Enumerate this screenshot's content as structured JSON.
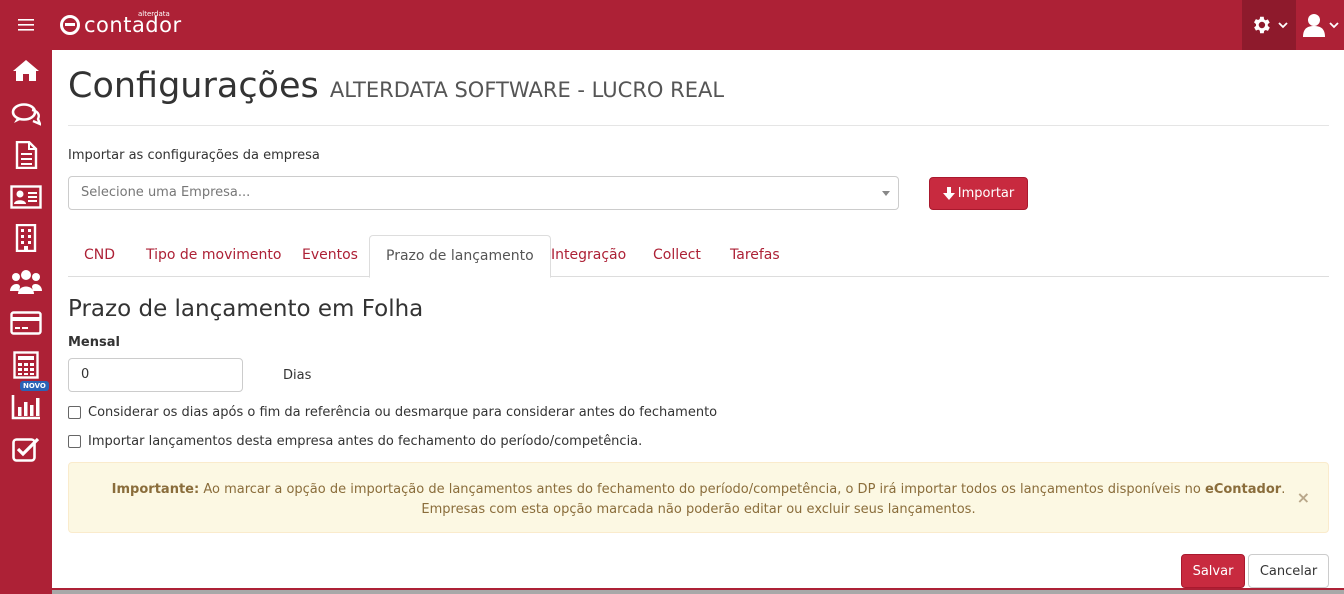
{
  "header": {
    "brand_small": "alterdata",
    "brand_word": "contador",
    "brand_color": "#ad2136"
  },
  "sidebar": {
    "items": [
      {
        "icon": "home-icon"
      },
      {
        "icon": "chat-icon"
      },
      {
        "icon": "document-icon"
      },
      {
        "icon": "contact-card-icon"
      },
      {
        "icon": "building-icon"
      },
      {
        "icon": "users-icon"
      },
      {
        "icon": "credit-card-icon"
      },
      {
        "icon": "calculator-icon"
      },
      {
        "icon": "bar-chart-icon"
      },
      {
        "icon": "checkbox-icon"
      }
    ],
    "novo_badge": "NOVO"
  },
  "page": {
    "title": "Configurações",
    "company": "ALTERDATA SOFTWARE - LUCRO REAL"
  },
  "import": {
    "label": "Importar as configurações da empresa",
    "select_placeholder": "Selecione uma Empresa...",
    "button": "Importar"
  },
  "tabs": [
    {
      "label": "CND",
      "active": false
    },
    {
      "label": "Tipo de movimento",
      "active": false
    },
    {
      "label": "Eventos",
      "active": false
    },
    {
      "label": "Prazo de lançamento",
      "active": true
    },
    {
      "label": "Integração",
      "active": false
    },
    {
      "label": "Collect",
      "active": false
    },
    {
      "label": "Tarefas",
      "active": false
    }
  ],
  "section": {
    "title": "Prazo de lançamento em Folha",
    "mensal_label": "Mensal",
    "mensal_value": "0",
    "dias_label": "Dias",
    "checkbox1": "Considerar os dias após o fim da referência ou desmarque para considerar antes do fechamento",
    "checkbox2": "Importar lançamentos desta empresa antes do fechamento do período/competência."
  },
  "alert": {
    "strong": "Importante:",
    "text1": " Ao marcar a opção de importação de lançamentos antes do fechamento do período/competência, o DP irá importar todos os lançamentos disponíveis no ",
    "strong2": "eContador",
    "text2": ". Empresas com esta opção marcada não poderão editar ou excluir seus lançamentos.",
    "close": "×"
  },
  "actions": {
    "save": "Salvar",
    "cancel": "Cancelar"
  }
}
